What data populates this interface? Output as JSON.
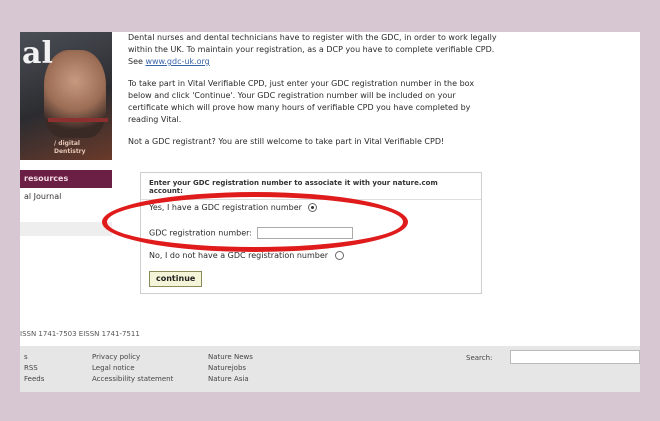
{
  "thumbnail": {
    "logo": "al",
    "caption_lines": [
      "/ digital",
      "Dentistry"
    ]
  },
  "sidebar": {
    "resources_label": "resources",
    "journal_link": "al Journal"
  },
  "content": {
    "para1_a": "Dental nurses and dental technicians have to register with the GDC, in order to work legally within the UK. To maintain your registration, as a DCP you have to complete verifiable CPD. See ",
    "para1_link": "www.gdc-uk.org",
    "para2": "To take part in Vital Verifiable CPD, just enter your GDC registration number in the box below and click 'Continue'. Your GDC registration number will be included on your certificate which will prove how many hours of verifiable CPD you have completed by reading Vital.",
    "para3": "Not a GDC registrant? You are still welcome to take part in Vital Verifiable CPD!"
  },
  "form": {
    "heading": "Enter your GDC registration number to associate it with your nature.com account:",
    "option_yes": "Yes, I have a GDC registration number",
    "reg_label": "GDC registration number:",
    "reg_value": "",
    "option_no": "No, I do not have a GDC registration number",
    "continue_label": "continue"
  },
  "issn": "ISSN 1741-7503   EISSN 1741-7511",
  "footer": {
    "col1": [
      "s",
      "RSS",
      "Feeds"
    ],
    "col2": [
      "Privacy policy",
      "Legal notice",
      "Accessibility statement"
    ],
    "col3": [
      "Nature News",
      "Naturejobs",
      "Nature Asia"
    ],
    "search_label": "Search:"
  }
}
